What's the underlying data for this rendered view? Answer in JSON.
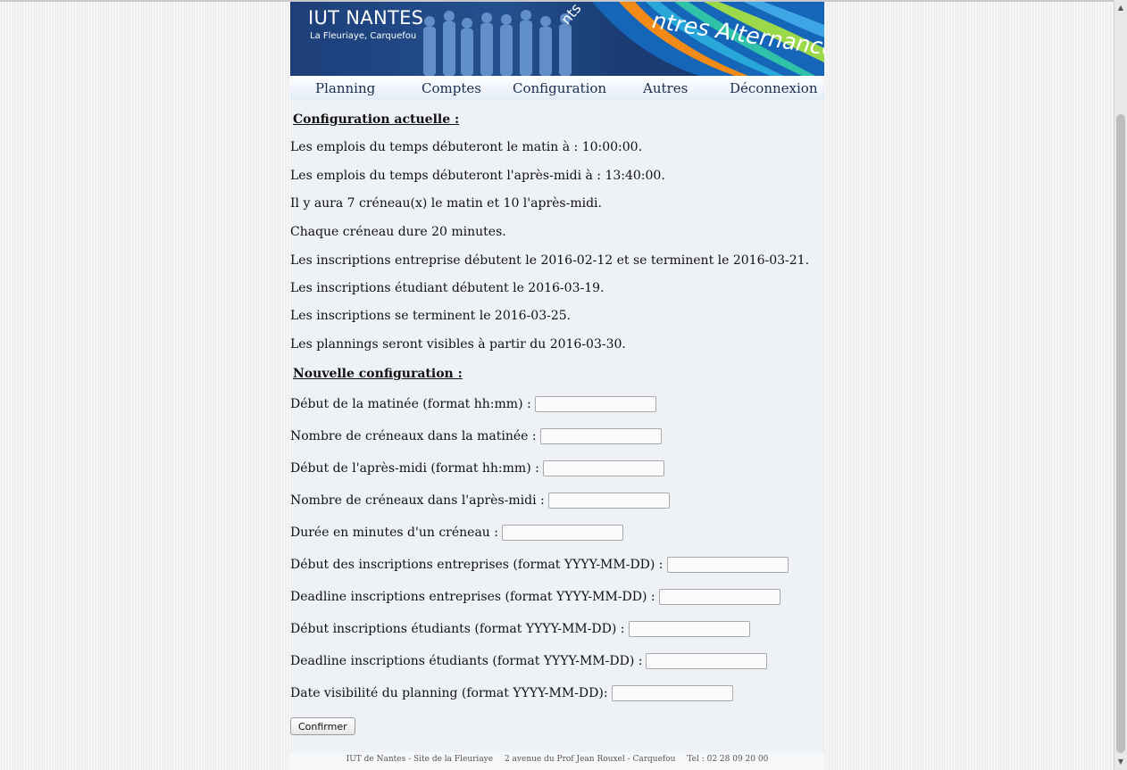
{
  "banner": {
    "title": "IUT NANTES",
    "subtitle": "La Fleuriaye, Carquefou",
    "slogan": "ntres Alternance",
    "slogan_left": "nts"
  },
  "nav": {
    "items": [
      "Planning",
      "Comptes",
      "Configuration",
      "Autres",
      "Déconnexion"
    ]
  },
  "current_config": {
    "title": "Configuration actuelle :",
    "lines": [
      "Les emplois du temps débuteront le matin à : 10:00:00.",
      "Les emplois du temps débuteront l'après-midi à : 13:40:00.",
      "Il y aura 7 créneau(x) le matin et 10 l'après-midi.",
      "Chaque créneau dure 20 minutes.",
      "Les inscriptions entreprise débutent le 2016-02-12 et se terminent le 2016-03-21.",
      "Les inscriptions étudiant débutent le 2016-03-19.",
      "Les inscriptions se terminent le 2016-03-25.",
      "Les plannings seront visibles à partir du 2016-03-30."
    ]
  },
  "new_config": {
    "title": "Nouvelle configuration :",
    "fields": [
      {
        "label": "Début de la matinée (format hh:mm) :",
        "value": ""
      },
      {
        "label": "Nombre de créneaux dans la matinée :",
        "value": ""
      },
      {
        "label": "Début de l'après-midi (format hh:mm) :",
        "value": ""
      },
      {
        "label": "Nombre de créneaux dans l'après-midi :",
        "value": ""
      },
      {
        "label": "Durée en minutes d'un créneau :",
        "value": ""
      },
      {
        "label": "Début des inscriptions entreprises (format YYYY-MM-DD) :",
        "value": ""
      },
      {
        "label": "Deadline inscriptions entreprises (format YYYY-MM-DD) :",
        "value": ""
      },
      {
        "label": "Début inscriptions étudiants (format YYYY-MM-DD) :",
        "value": ""
      },
      {
        "label": "Deadline inscriptions étudiants (format YYYY-MM-DD) :",
        "value": ""
      },
      {
        "label": "Date visibilité du planning (format YYYY-MM-DD):",
        "value": ""
      }
    ],
    "submit_label": "Confirmer"
  },
  "footer": {
    "site": "IUT de Nantes - Site de la Fleuriaye",
    "address": "2 avenue du Prof Jean Rouxel - Carquefou",
    "phone": "Tel : 02 28 09 20 00"
  },
  "colors": {
    "banner_blue": "#1d3f79",
    "nav_text": "#1a2f4d",
    "page_bg": "#eef1f6"
  }
}
